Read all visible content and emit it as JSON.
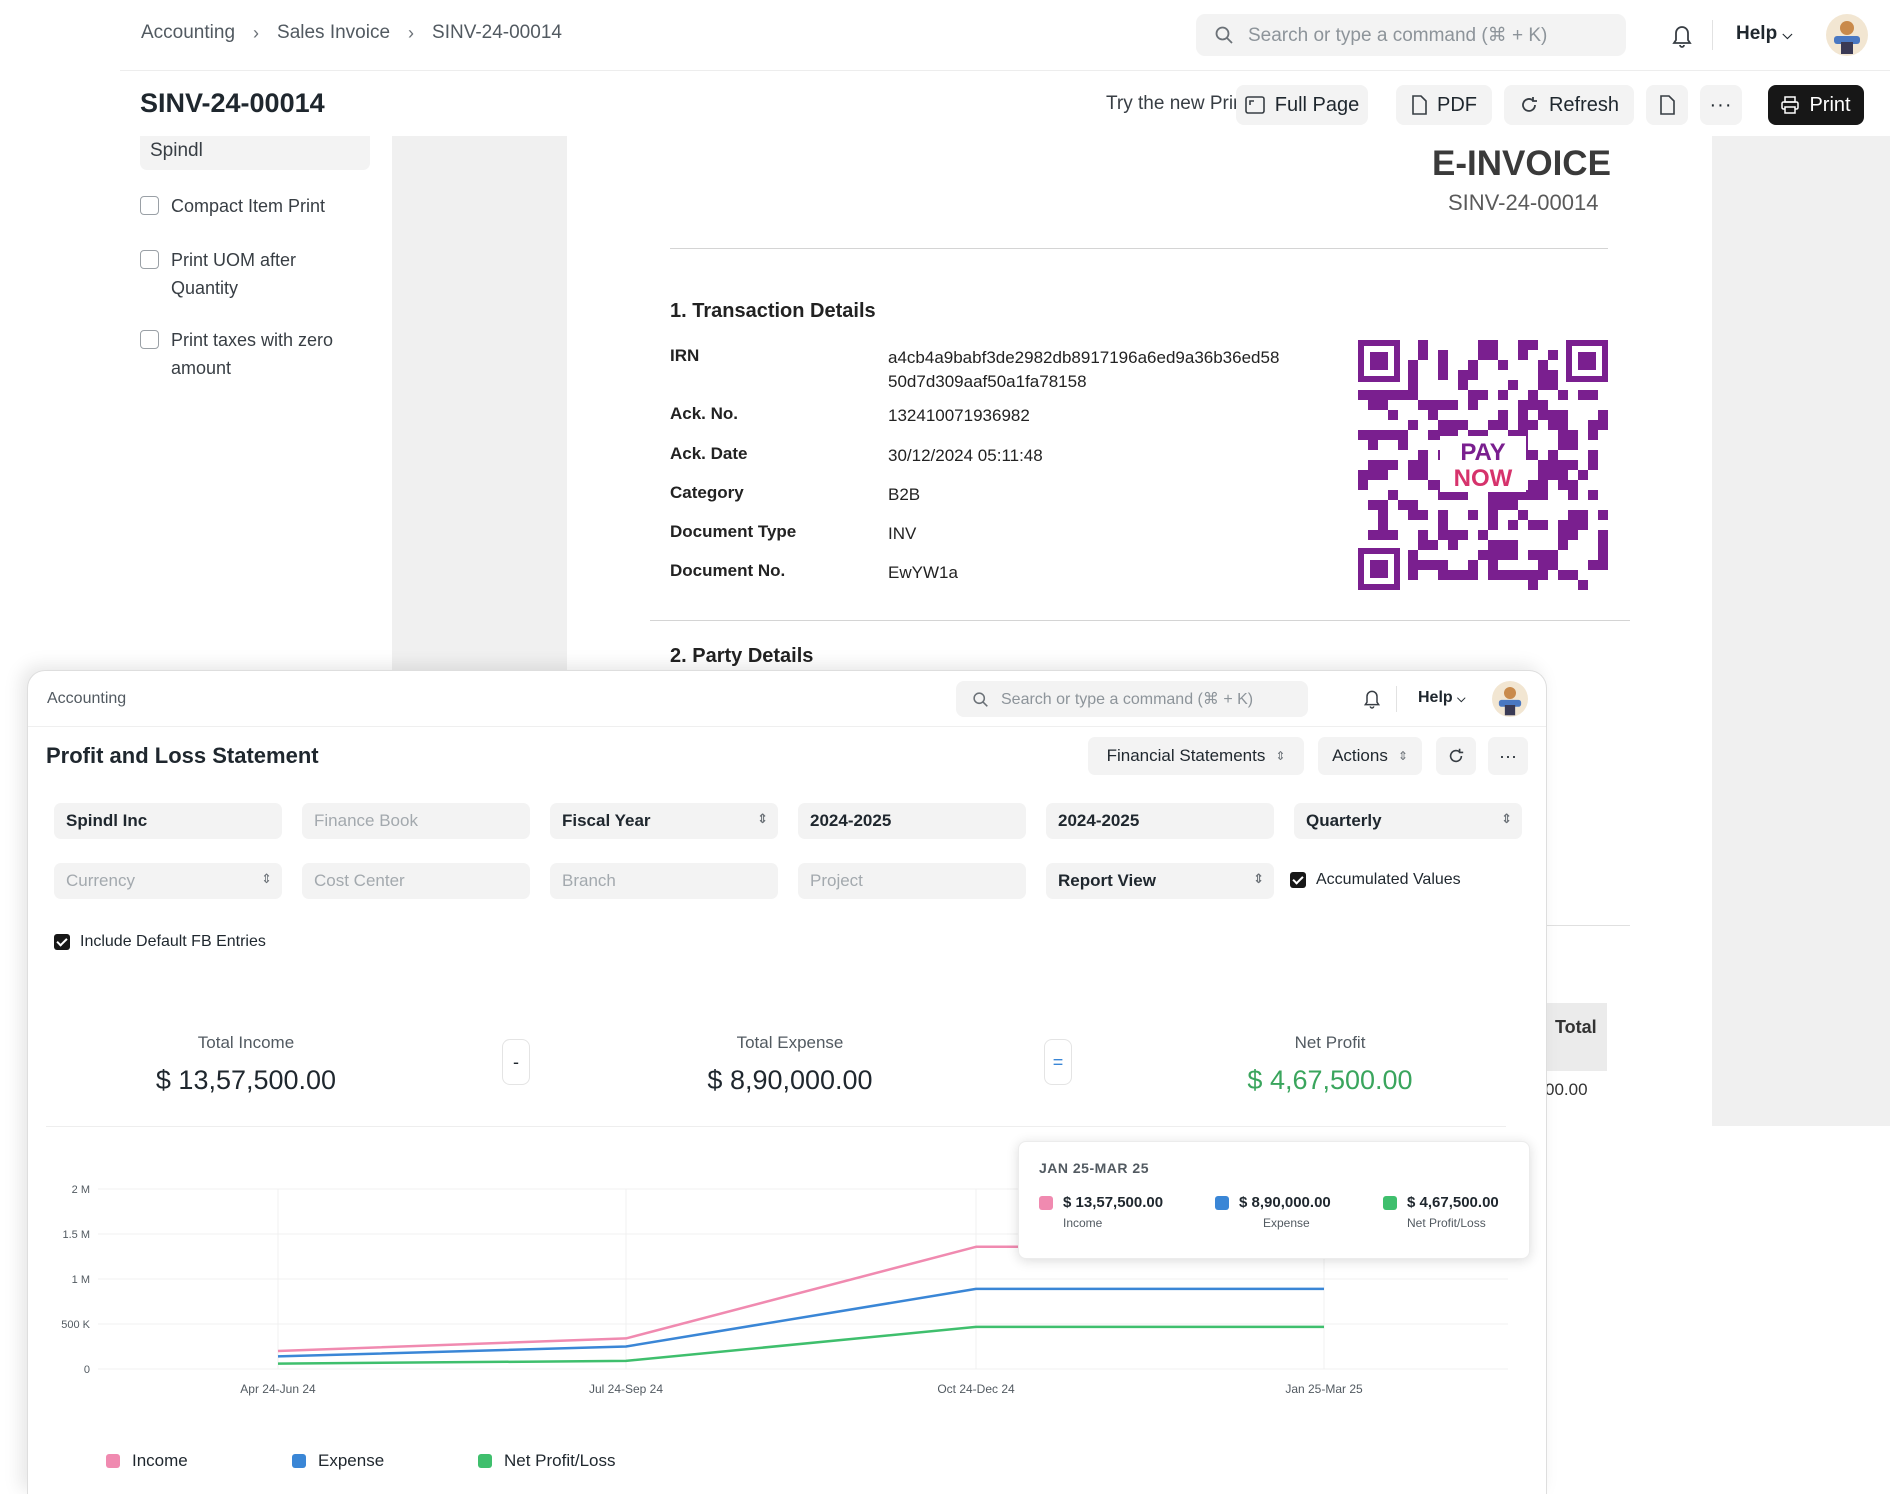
{
  "back": {
    "breadcrumbs": [
      "Accounting",
      "Sales Invoice",
      "SINV-24-00014"
    ],
    "search_placeholder": "Search or type a command (⌘ + K)",
    "help_label": "Help",
    "page_title": "SINV-24-00014",
    "try_print_designer": "Try the new Print Designer",
    "buttons": {
      "full_page": "Full Page",
      "pdf": "PDF",
      "refresh": "Refresh",
      "print": "Print"
    },
    "left_panel": {
      "letterhead_value": "Spindl",
      "checkboxes": [
        {
          "label": "Compact Item Print"
        },
        {
          "label": "Print UOM after Quantity"
        },
        {
          "label": "Print taxes with zero amount"
        }
      ]
    },
    "invoice": {
      "title": "E-INVOICE",
      "number": "SINV-24-00014",
      "section1_title": "1. Transaction Details",
      "details": [
        {
          "key": "IRN",
          "value": "a4cb4a9babf3de2982db8917196a6ed9a36b36ed5850d7d309aaf50a1fa78158"
        },
        {
          "key": "Ack. No.",
          "value": "132410071936982"
        },
        {
          "key": "Ack. Date",
          "value": "30/12/2024 05:11:48"
        },
        {
          "key": "Category",
          "value": "B2B"
        },
        {
          "key": "Document Type",
          "value": "INV"
        },
        {
          "key": "Document No.",
          "value": "EwYW1a"
        }
      ],
      "qr_overlay_line1": "PAY",
      "qr_overlay_line2": "NOW",
      "section2_title": "2. Party Details",
      "table_total_header": "Total",
      "table_total_value_partial": "00.00"
    }
  },
  "front": {
    "breadcrumb": "Accounting",
    "search_placeholder": "Search or type a command (⌘ + K)",
    "help_label": "Help",
    "title": "Profit and Loss Statement",
    "buttons": {
      "financial_statements": "Financial Statements",
      "actions": "Actions"
    },
    "filters_row1": {
      "company": "Spindl Inc",
      "finance_book_placeholder": "Finance Book",
      "filter_based_on": "Fiscal Year",
      "from_fiscal_year": "2024-2025",
      "to_fiscal_year": "2024-2025",
      "periodicity": "Quarterly"
    },
    "filters_row2": {
      "currency_placeholder": "Currency",
      "cost_center_placeholder": "Cost Center",
      "branch_placeholder": "Branch",
      "project_placeholder": "Project",
      "report_view": "Report View",
      "accumulated_values": "Accumulated Values"
    },
    "include_default_fb": "Include Default FB Entries",
    "summary": {
      "income_label": "Total Income",
      "income_value": "$ 13,57,500.00",
      "minus_op": "-",
      "expense_label": "Total Expense",
      "expense_value": "$ 8,90,000.00",
      "equals_op": "=",
      "profit_label": "Net Profit",
      "profit_value": "$ 4,67,500.00"
    },
    "tooltip": {
      "title": "JAN 25-MAR 25",
      "items": [
        {
          "value": "$ 13,57,500.00",
          "label": "Income",
          "color": "#f08ab0"
        },
        {
          "value": "$ 8,90,000.00",
          "label": "Expense",
          "color": "#3a86d6"
        },
        {
          "value": "$ 4,67,500.00",
          "label": "Net Profit/Loss",
          "color": "#3fbf6d"
        }
      ]
    }
  },
  "chart_data": {
    "type": "line",
    "categories": [
      "Apr 24-Jun 24",
      "Jul 24-Sep 24",
      "Oct 24-Dec 24",
      "Jan 25-Mar 25"
    ],
    "y_ticks": [
      "0",
      "500 K",
      "1 M",
      "1.5 M",
      "2 M"
    ],
    "ylim": [
      0,
      2000000
    ],
    "grid": true,
    "legend_position": "bottom-left",
    "series": [
      {
        "name": "Income",
        "color": "#f08ab0",
        "values": [
          200000,
          340000,
          1357500,
          1357500
        ]
      },
      {
        "name": "Expense",
        "color": "#3a86d6",
        "values": [
          140000,
          250000,
          890000,
          890000
        ]
      },
      {
        "name": "Net Profit/Loss",
        "color": "#3fbf6d",
        "values": [
          60000,
          90000,
          467500,
          467500
        ]
      }
    ]
  }
}
